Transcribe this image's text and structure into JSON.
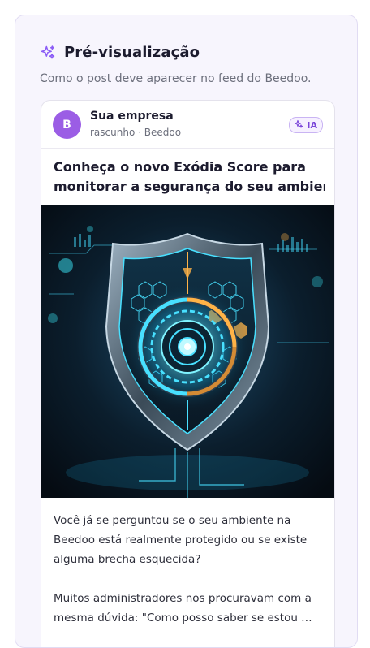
{
  "preview": {
    "title": "Pré-visualização",
    "subtitle": "Como o post deve aparecer no feed do Beedoo.",
    "icon": "sparkles-icon",
    "accent_color": "#7b46d9"
  },
  "post": {
    "avatar_letter": "B",
    "avatar_color": "#9b5de5",
    "author": "Sua empresa",
    "meta": "rascunho · Beedoo",
    "badge": "IA",
    "title_lines": [
      "Conheça o novo Exódia Score para",
      "monitorar a segurança do seu ambien…"
    ],
    "image_description_icon": "cyber-shield-image",
    "body_lines": [
      "Você já se perguntou se o seu ambiente na",
      "Beedoo está realmente protegido ou se existe",
      "alguma brecha esquecida?",
      "",
      "Muitos administradores nos procuravam com a",
      "mesma dúvida: \"Como posso saber se estou …"
    ]
  }
}
